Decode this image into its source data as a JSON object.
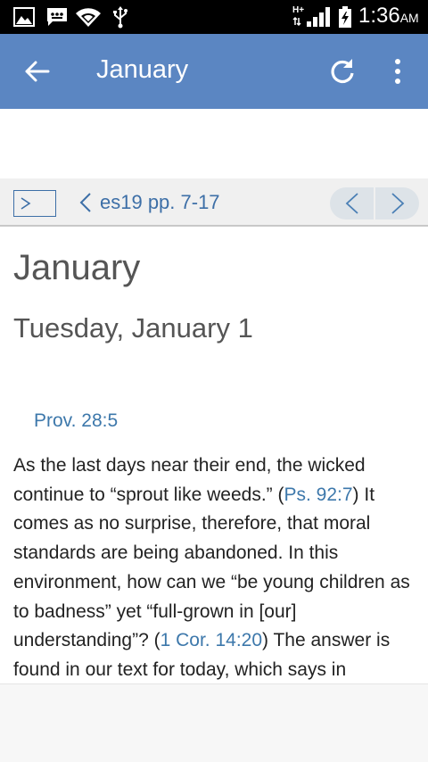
{
  "status_bar": {
    "time": "1:36",
    "ampm": "AM",
    "signal_label": "H+",
    "icons": [
      "image-icon",
      "chat-icon",
      "wifi-icon",
      "usb-icon",
      "signal-icon",
      "battery-icon"
    ]
  },
  "app_bar": {
    "title": "January",
    "color": "#5b86c2",
    "icons": [
      "back-arrow-icon",
      "refresh-icon",
      "more-vert-icon"
    ]
  },
  "nav": {
    "reference": "es19 pp. 7-17",
    "accent": "#3d6fa7"
  },
  "article": {
    "heading": "January",
    "subheading": "Tuesday, January 1",
    "scripture": "Prov. 28:5",
    "paragraph": {
      "part1": "As the last days near their end, the wicked continue to “sprout like weeds.” (",
      "link1": "Ps. 92:7",
      "part2": ") It comes as no surprise, therefore, that moral standards are being abandoned. In this environment, how can we “be young children as to badness” yet “full-grown in [our] understanding”? (",
      "link2": "1 Cor. 14:20",
      "part3": ") The answer is found in our text for today, which says in"
    },
    "link_color": "#3d78ab"
  }
}
